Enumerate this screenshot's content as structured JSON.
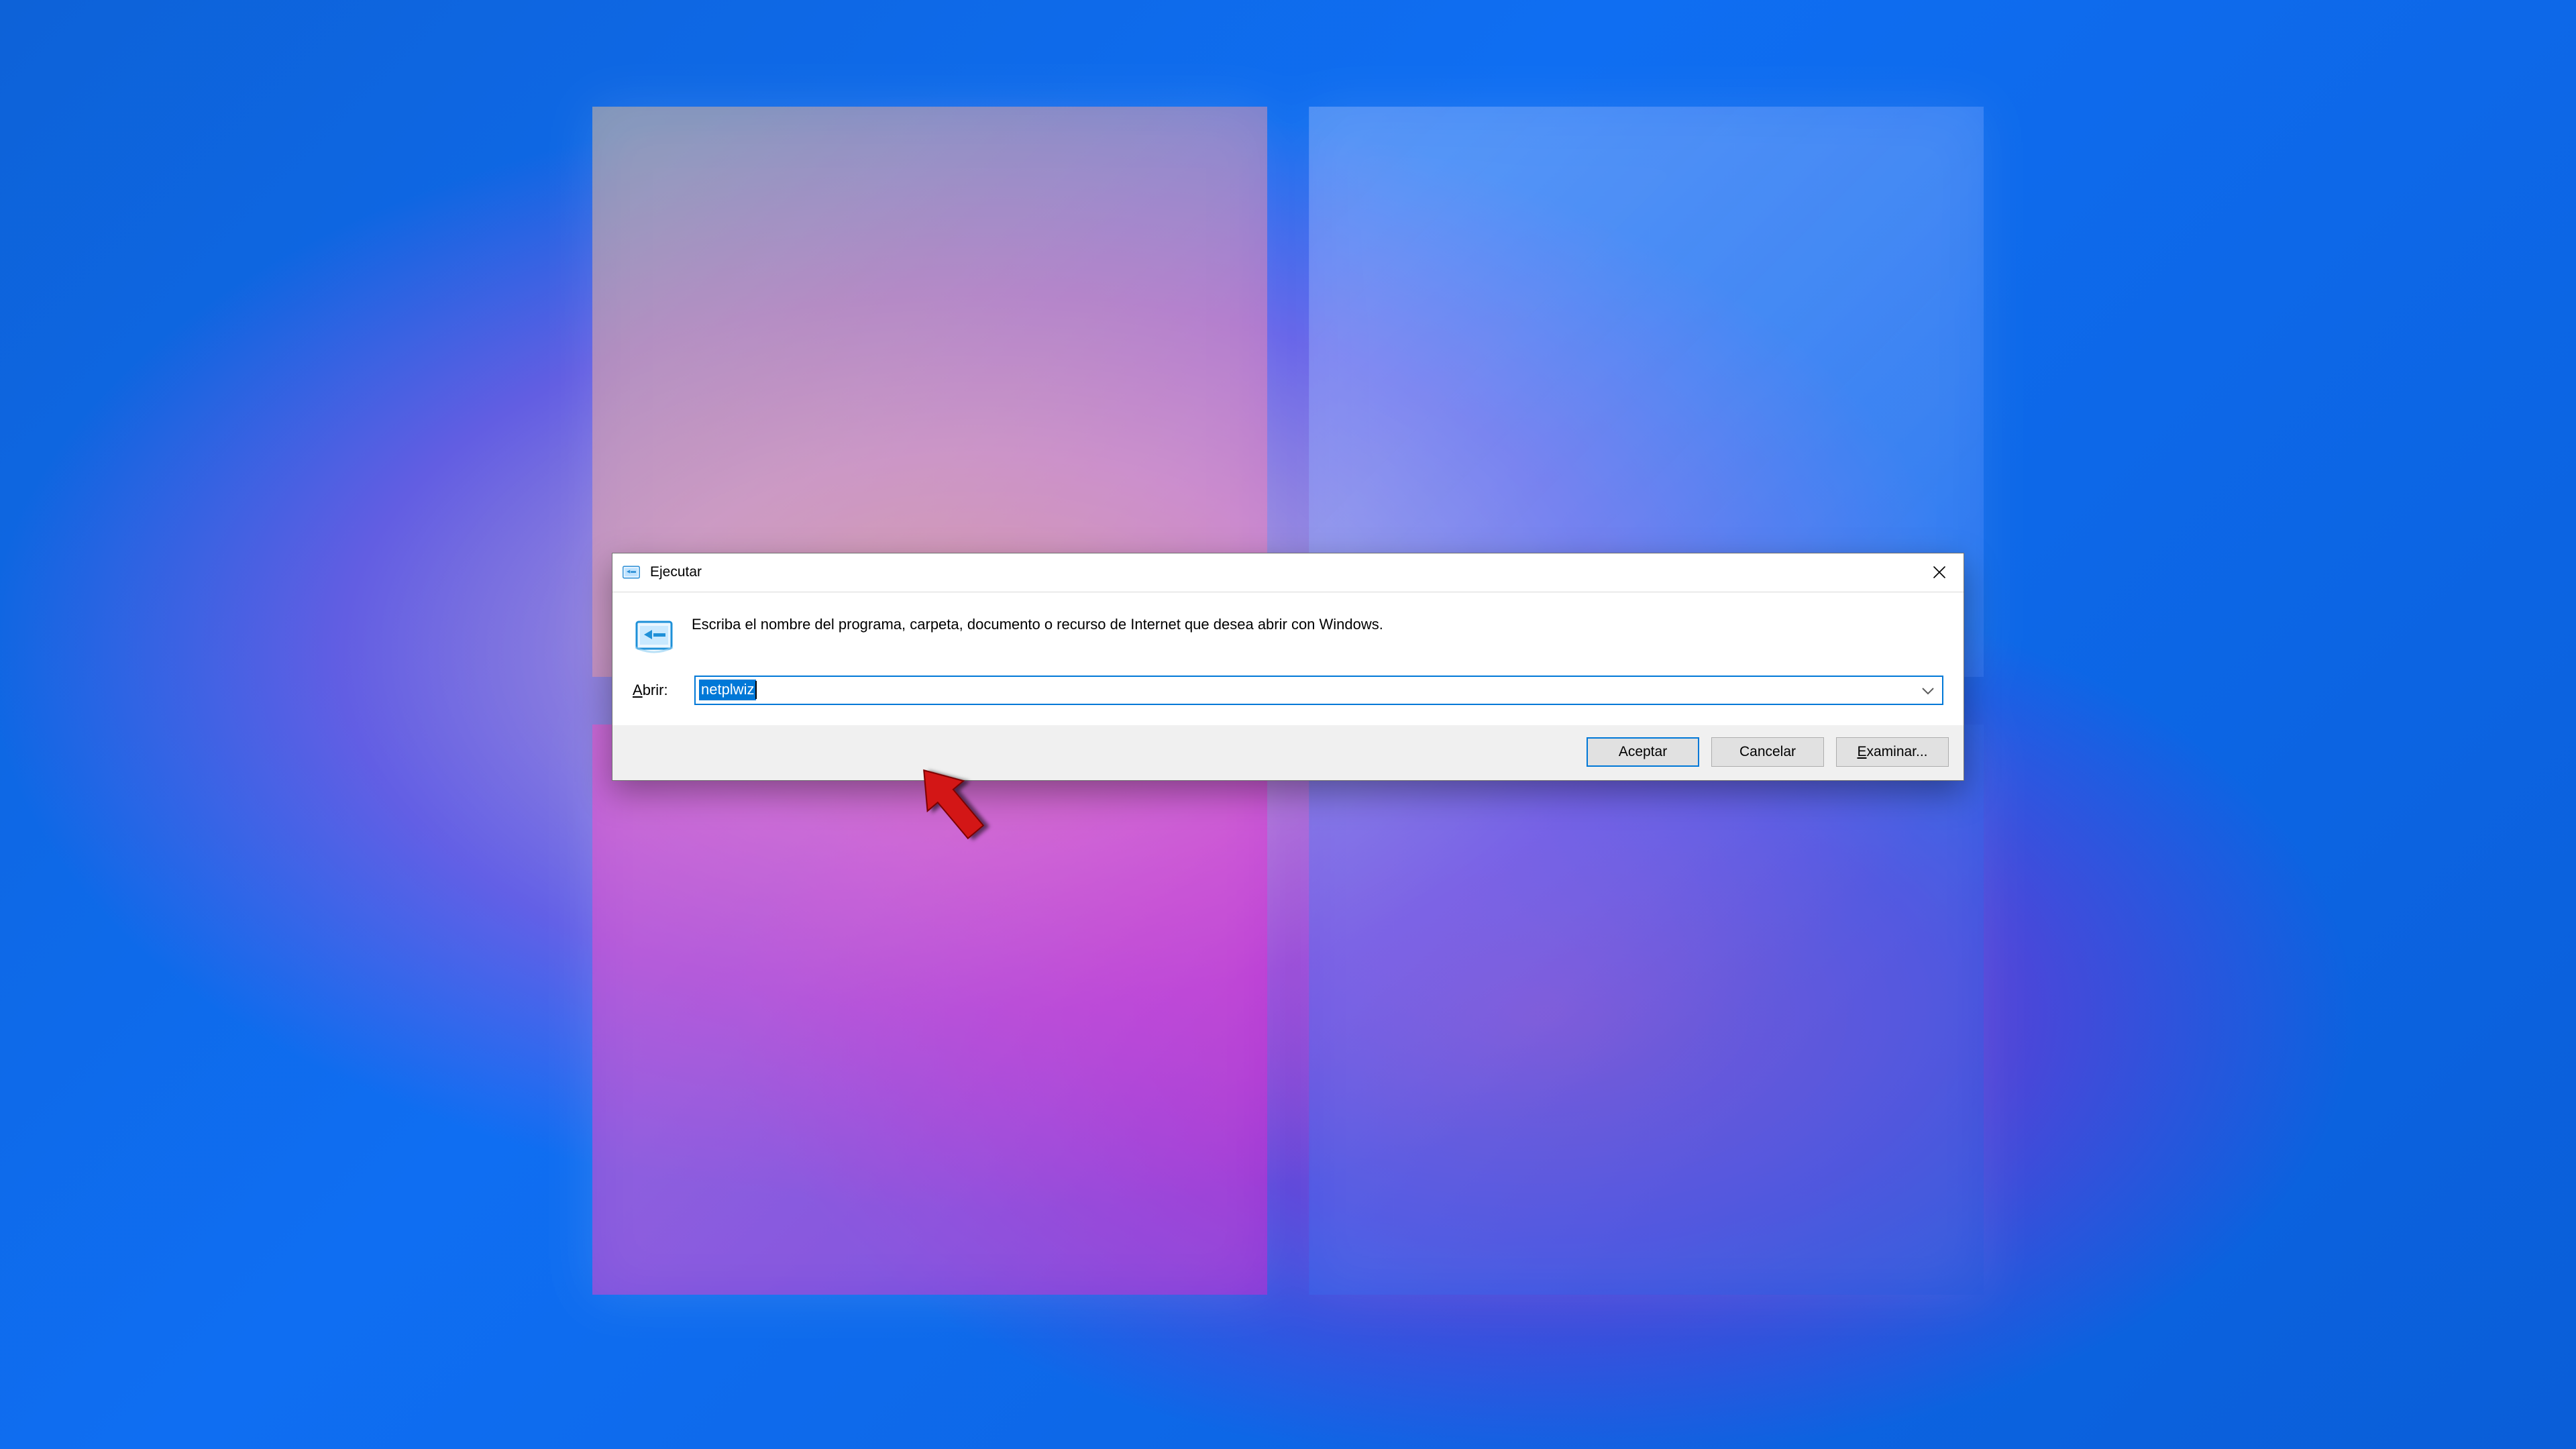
{
  "dialog": {
    "title": "Ejecutar",
    "description": "Escriba el nombre del programa, carpeta, documento o recurso de Internet que desea abrir con Windows.",
    "open_label_pre": "A",
    "open_label_post": "brir:",
    "input_value": "netplwiz",
    "buttons": {
      "accept": "Aceptar",
      "cancel": "Cancelar",
      "browse_pre": "E",
      "browse_post": "xaminar..."
    }
  }
}
